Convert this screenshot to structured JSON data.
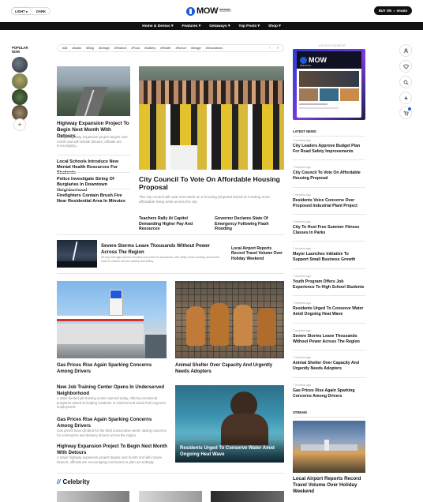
{
  "header": {
    "light": "LIGHT",
    "dark": "DARK",
    "logo": "MOW",
    "tagline_1": "BREAKING",
    "tagline_2": "MAGAZINE.IT",
    "buy": "BUY ON",
    "envato": "envato"
  },
  "nav": [
    {
      "label": "Home & Demos"
    },
    {
      "label": "Features"
    },
    {
      "label": "Getaways"
    },
    {
      "label": "Top Posts"
    },
    {
      "label": "Shop"
    }
  ],
  "popular": {
    "label_1": "POPULAR",
    "label_2": "NOW",
    "add": "+"
  },
  "tags": [
    "#All",
    "#Audio",
    "#Blog",
    "#Design",
    "#Fashion",
    "#Food",
    "#Gallery",
    "#Health",
    "#Humor",
    "#Image",
    "#Innovations"
  ],
  "left_feature": {
    "title": "Highway Expansion Project To Begin Next Month With Detours",
    "excerpt": "A major highway expansion project begins next month and will include detours; officials are encouraging..."
  },
  "left_list": [
    "Local Schools Introduce New Mental Health Resources For Students",
    "Police Investigate String Of Burglaries In Downtown Neighborhood",
    "Firefighters Contain Brush Fire Near Residential Area In Minutes"
  ],
  "main_feature": {
    "title": "City Council To Vote On Affordable Housing Proposal",
    "excerpt": "The city council will vote next week on a housing proposal aimed at creating more affordable living units across the city."
  },
  "main_subs": [
    "Teachers Rally At Capitol Demanding Higher Pay And Resources",
    "Governor Declares State Of Emergency Following Flash Flooding"
  ],
  "storm": {
    "title": "Severe Storms Leave Thousands Without Power Across The Region",
    "excerpt": "Strong overnight storms knocked out power to thousands, with utility crews working around the clock to restore service quickly and safely."
  },
  "airport_small": "Local Airport Reports Record Travel Volume Over Holiday Weekend",
  "cards": [
    {
      "title": "Gas Prices Rise Again Sparking Concerns Among Drivers"
    },
    {
      "title": "Animal Shelter Over Capacity And Urgently Needs Adopters"
    }
  ],
  "bottom_list": [
    {
      "title": "New Job Training Center Opens In Underserved Neighborhood",
      "excerpt": "A state-funded job training center opened today, offering vocational programs aimed at helping residents in underserved areas find long-term employment."
    },
    {
      "title": "Gas Prices Rise Again Sparking Concerns Among Drivers",
      "excerpt": "Gas prices have climbed for the third consecutive week, raising concerns for commuters and delivery drivers across the region."
    },
    {
      "title": "Highway Expansion Project To Begin Next Month With Detours",
      "excerpt": "A major highway expansion project begins next month and will include detours; officials are encouraging commuters to plan accordingly."
    }
  ],
  "overlay": {
    "title": "Residents Urged To Conserve Water Amid Ongoing Heat Wave"
  },
  "celebrity": {
    "slashes": "//",
    "label": "Celebrity"
  },
  "sidebar": {
    "ad_label": "ADVERTISEMENT",
    "ad_logo": "MOW",
    "ad_sub": "BREAKING",
    "latest_label": "LATEST NEWS",
    "stream_label": "STREAM",
    "latest": [
      {
        "time": "7 months ago",
        "title": "City Leaders Approve Budget Plan For Road Safety Improvements"
      },
      {
        "time": "7 months ago",
        "title": "City Council To Vote On Affordable Housing Proposal"
      },
      {
        "time": "7 months ago",
        "title": "Residents Voice Concerns Over Proposed Industrial Plant Project"
      },
      {
        "time": "7 months ago",
        "title": "City To Host Free Summer Fitness Classes In Parks"
      },
      {
        "time": "7 months ago",
        "title": "Mayor Launches Initiative To Support Small Business Growth"
      },
      {
        "time": "7 months ago",
        "title": "Youth Program Offers Job Experience To High School Students"
      },
      {
        "time": "7 months ago",
        "title": "Residents Urged To Conserve Water Amid Ongoing Heat Wave"
      },
      {
        "time": "7 months ago",
        "title": "Severe Storms Leave Thousands Without Power Across The Region"
      },
      {
        "time": "7 months ago",
        "title": "Animal Shelter Over Capacity And Urgently Needs Adopters"
      },
      {
        "time": "7 months ago",
        "title": "Gas Prices Rise Again Sparking Concerns Among Drivers"
      }
    ],
    "stream_title": "Local Airport Reports Record Travel Volume Over Holiday Weekend"
  },
  "colors": {
    "accent": "#1e5bd8",
    "nav": "#111111"
  },
  "icons": {
    "user": "user-icon",
    "heart": "heart-icon",
    "search": "search-icon",
    "bolt": "bolt-icon",
    "cart": "cart-icon"
  }
}
